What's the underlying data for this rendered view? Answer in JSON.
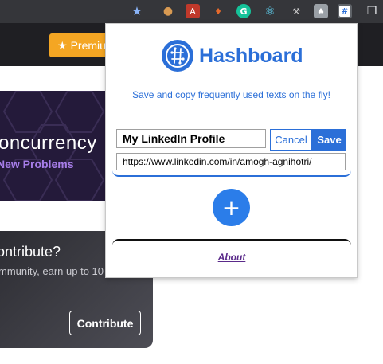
{
  "toolbar": {
    "icons": [
      "star-icon",
      "cookie-icon",
      "pdf-icon",
      "fire-icon",
      "grammarly-icon",
      "react-icon",
      "tools-icon",
      "mushroom-icon",
      "hashboard-icon",
      "tabs-icon"
    ],
    "glyphs": {
      "star": "★",
      "cookie": "●",
      "pdf": "A",
      "fire": "♦",
      "grammarly": "G",
      "react": "⚛",
      "tools": "⚒",
      "mushroom": "♠",
      "hashboard": "#",
      "tabs": "❐"
    }
  },
  "page": {
    "premium_label": "Premium",
    "premium_star": "★",
    "banner": {
      "title": "oncurrency",
      "subtitle": "New Problems"
    },
    "contribute": {
      "title": "ontribute?",
      "text": "mmunity, earn up to 10",
      "button": "Contribute"
    }
  },
  "popup": {
    "brand_name": "Hashboard",
    "tagline": "Save and copy frequently used texts on the fly!",
    "entry": {
      "title_value": "My LinkedIn Profile",
      "value_value": "https://www.linkedin.com/in/amogh-agnihotri/",
      "cancel_label": "Cancel",
      "save_label": "Save"
    },
    "add_glyph": "+",
    "about_label": "About"
  },
  "colors": {
    "accent": "#2b6fd8",
    "add_button": "#2b7de9",
    "premium": "#f4a623",
    "banner_bg": "#241a3a",
    "banner_sub": "#a67de8",
    "about_link": "#5a2a8a"
  }
}
